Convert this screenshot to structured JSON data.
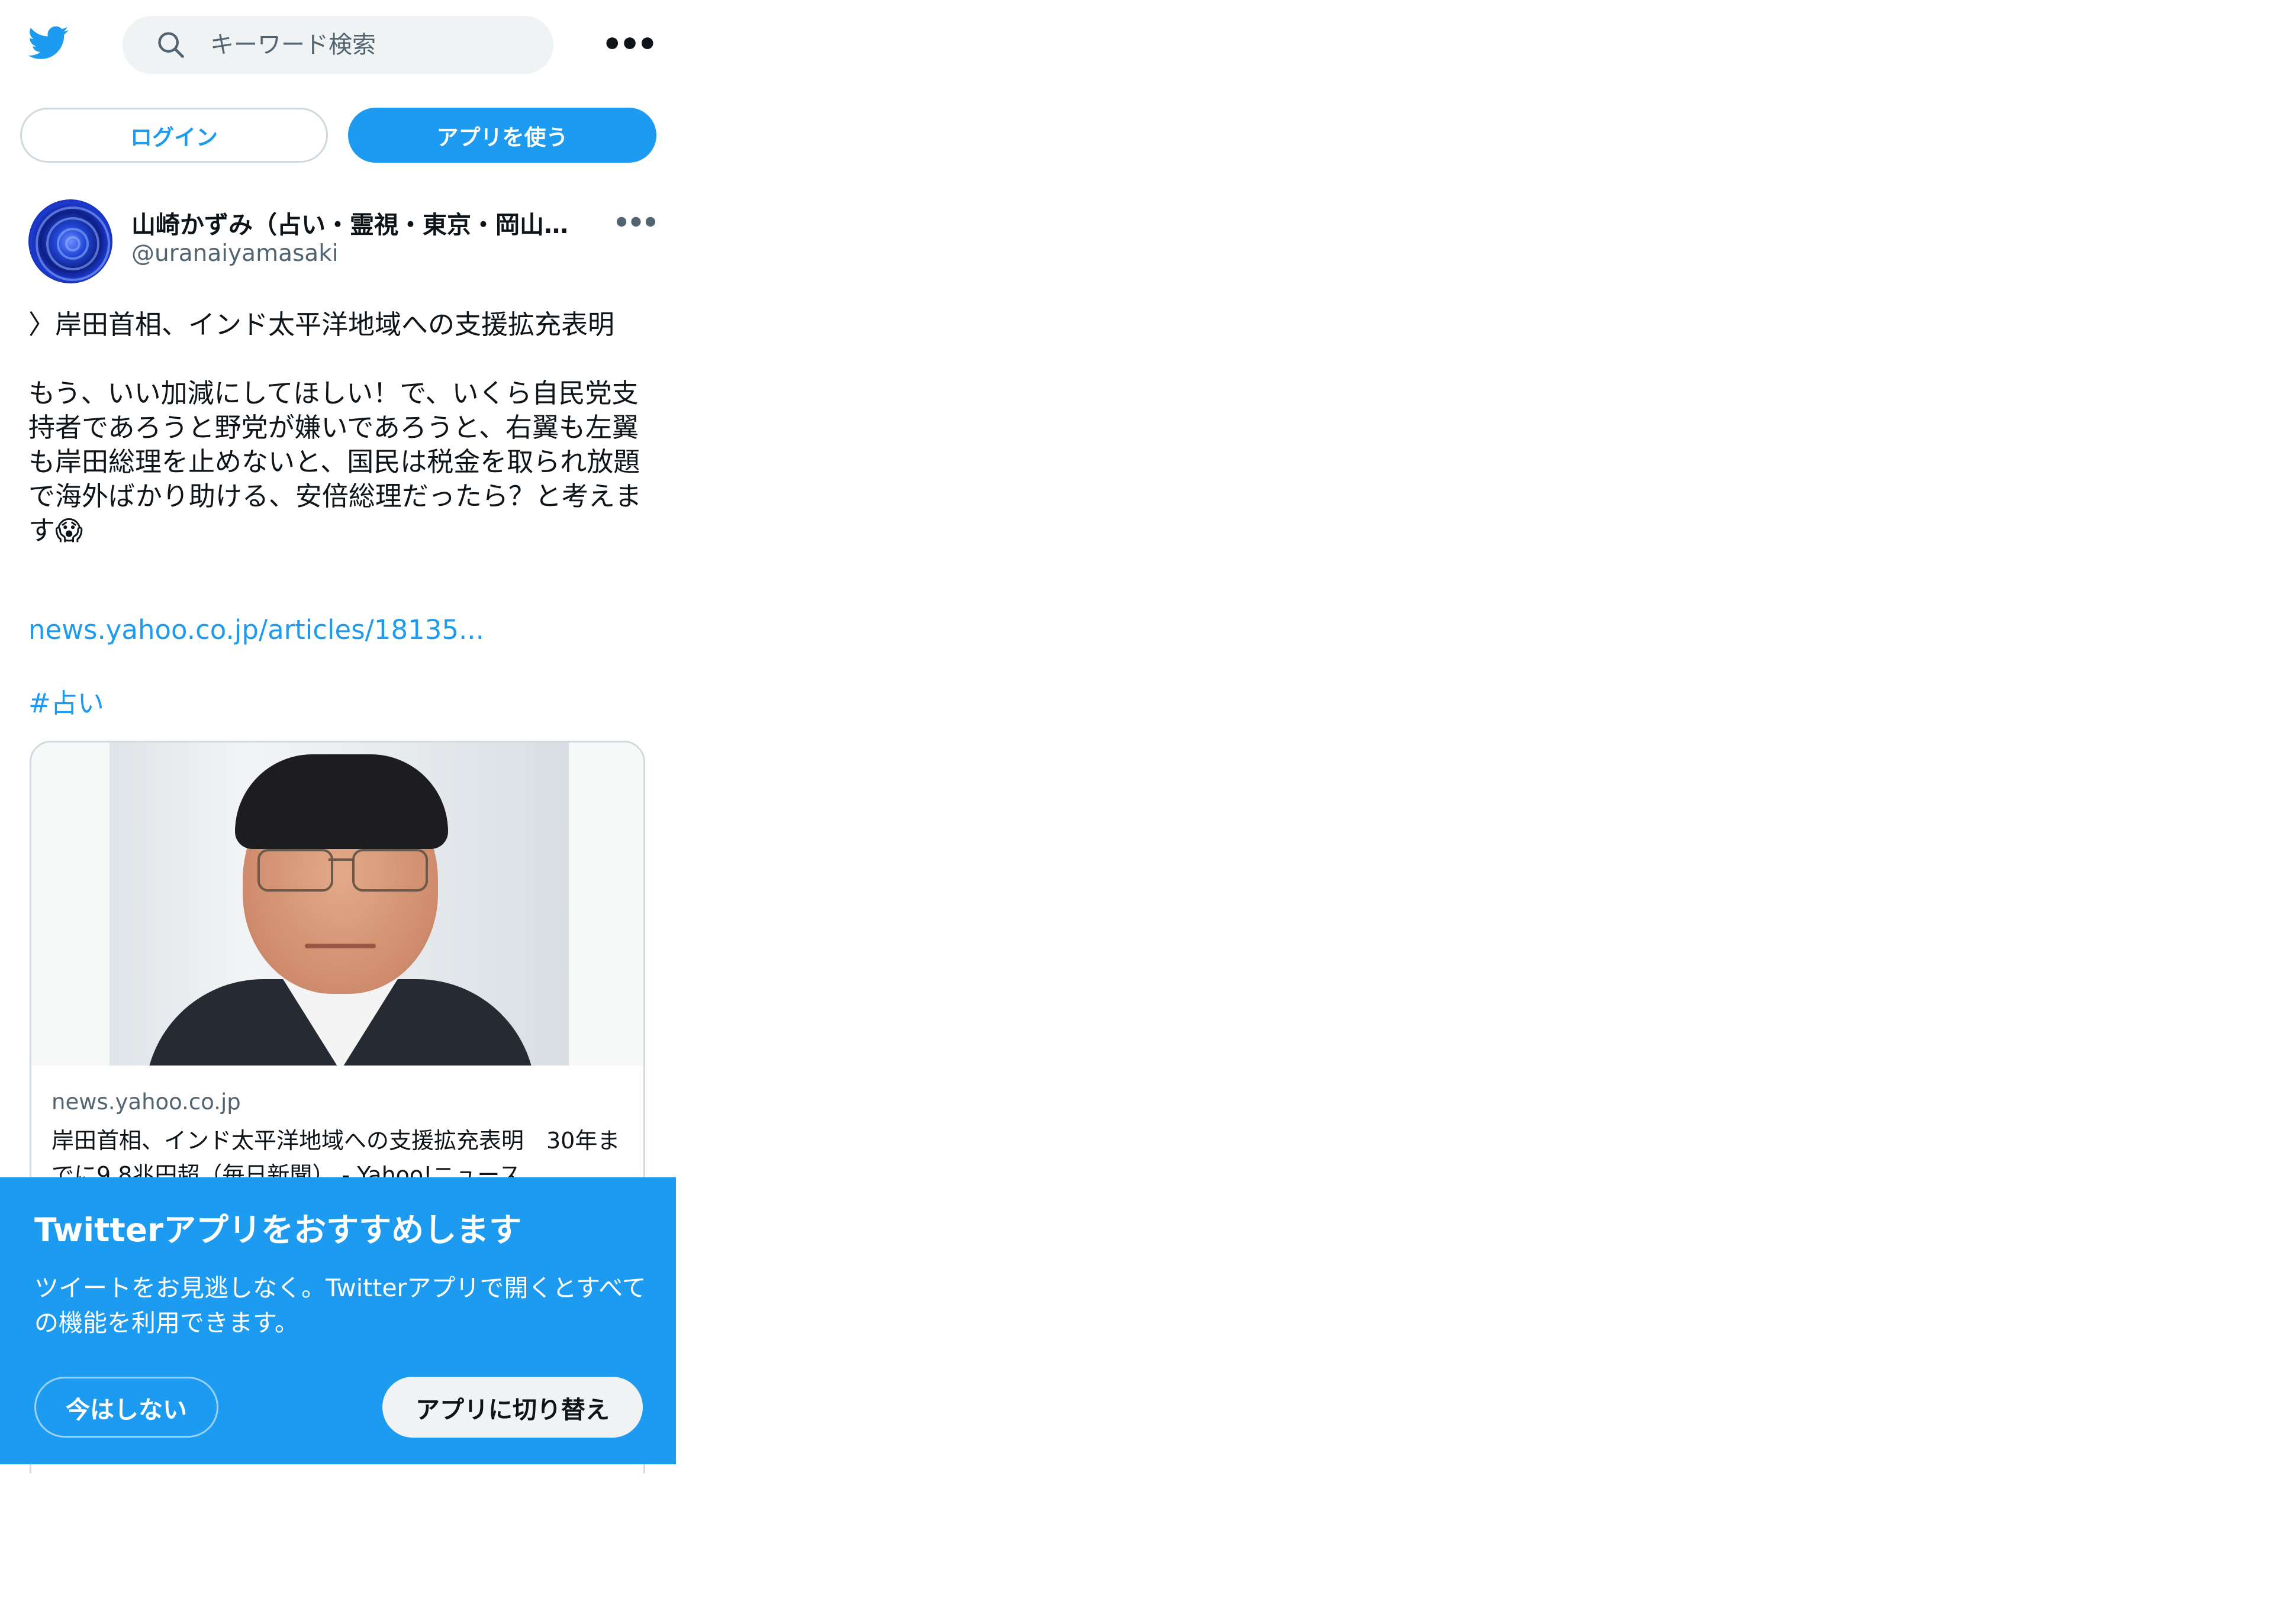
{
  "header": {
    "logo_icon": "twitter-bird-icon",
    "search_placeholder": "キーワード検索",
    "search_icon": "search-icon",
    "more_label": "•••"
  },
  "auth": {
    "login_label": "ログイン",
    "use_app_label": "アプリを使う"
  },
  "tweet": {
    "author_name": "山崎かずみ（占い・霊視・東京・岡山…",
    "author_handle": "@uranaiyamasaki",
    "more_label": "•••",
    "text": "〉岸田首相、インド太平洋地域への支援拡充表明\n\nもう、いい加減にしてほしい！で、いくら自民党支持者であろうと野党が嫌いであろうと、右翼も左翼も岸田総理を止めないと、国民は税金を取られ放題で海外ばかり助ける、安倍総理だったら？と考えます😱",
    "link": "news.yahoo.co.jp/articles/18135...",
    "hashtag": "#占い",
    "card": {
      "domain": "news.yahoo.co.jp",
      "title": "岸田首相、インド太平洋地域への支援拡充表明　30年までに9.8兆円超（毎日新聞） - Yahoo!ニュース"
    }
  },
  "promo": {
    "title": "Twitterアプリをおすすめします",
    "description": "ツイートをお見逃しなく。Twitterアプリで開くとすべての機能を利用できます。",
    "not_now_label": "今はしない",
    "switch_label": "アプリに切り替え"
  },
  "colors": {
    "brand_blue": "#1d9bf0",
    "text_primary": "#0f1419",
    "text_secondary": "#536471",
    "border": "#cfd9de"
  }
}
